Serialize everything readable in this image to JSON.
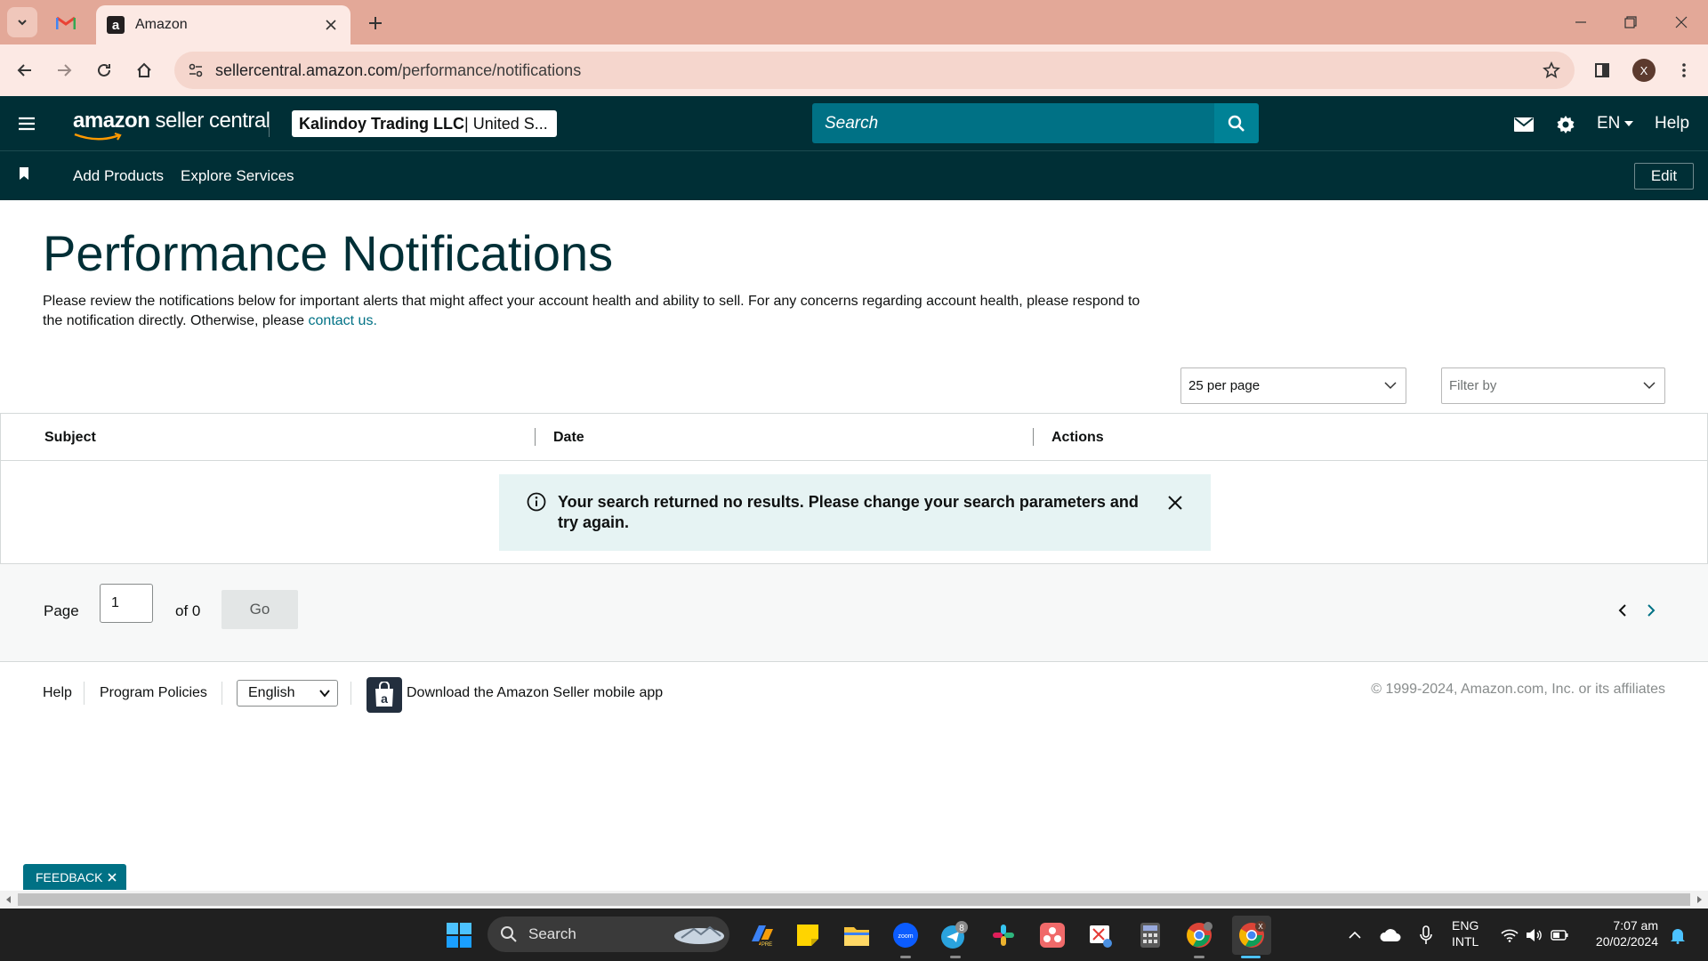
{
  "browser": {
    "tab_title": "Amazon",
    "url_host": "sellercentral.amazon.com",
    "url_path": "/performance/notifications",
    "profile_initial": "X"
  },
  "header": {
    "logo_bold": "amazon",
    "logo_rest": " seller central",
    "account_name": "Kalindoy Trading LLC",
    "account_region": " | United S...",
    "search_placeholder": "Search",
    "language": "EN",
    "help": "Help"
  },
  "subnav": {
    "links": [
      "Add Products",
      "Explore Services"
    ],
    "edit": "Edit"
  },
  "page": {
    "title": "Performance Notifications",
    "intro_text": "Please review the notifications below for important alerts that might affect your account health and ability to sell. For any concerns regarding account health, please respond to the notification directly. Otherwise, please ",
    "intro_link": "contact us.",
    "per_page": "25 per page",
    "filter_placeholder": "Filter by"
  },
  "table": {
    "columns": [
      "Subject",
      "Date",
      "Actions"
    ],
    "alert": "Your search returned no results. Please change your search parameters and try again."
  },
  "pager": {
    "page_label": "Page",
    "page_value": "1",
    "of_label": "of 0",
    "go": "Go"
  },
  "footer": {
    "help": "Help",
    "program_policies": "Program Policies",
    "language": "English",
    "app_download": "Download the Amazon Seller mobile app",
    "copyright": "© 1999-2024, Amazon.com, Inc. or its affiliates"
  },
  "feedback": "FEEDBACK",
  "taskbar": {
    "search": "Search",
    "telegram_badge": "8",
    "chrome_profile_badge": "X",
    "lang_top": "ENG",
    "lang_bottom": "INTL",
    "time": "7:07 am",
    "date": "20/02/2024"
  },
  "colors": {
    "header_bg": "#002f36",
    "accent": "#007185",
    "alert_bg": "#e6f3f3",
    "tabstrip_bg": "#e3a898"
  }
}
